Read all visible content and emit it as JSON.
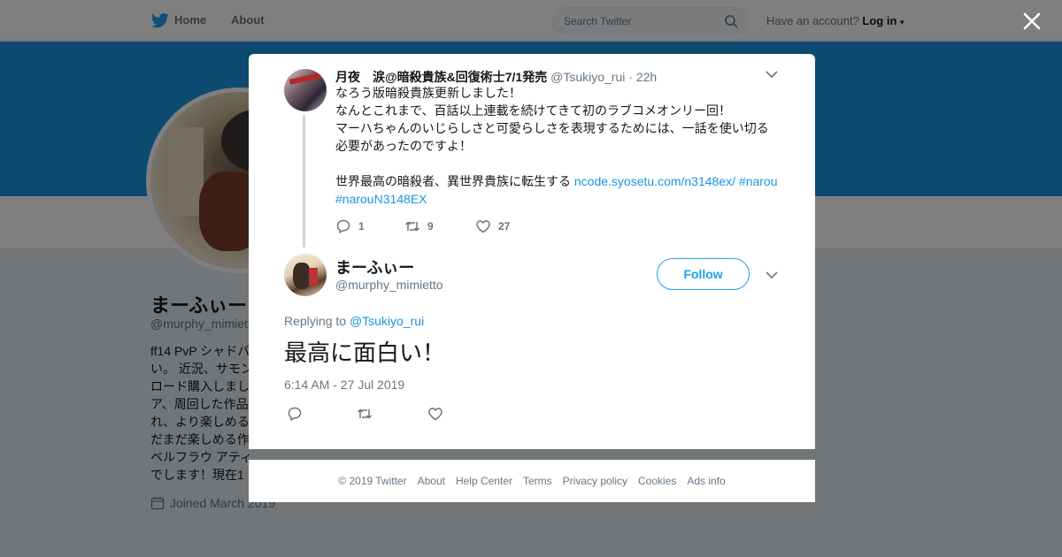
{
  "topbar": {
    "home_label": "Home",
    "about_label": "About",
    "search_placeholder": "Search Twitter",
    "account_prompt": "Have an account?",
    "login_label": "Log in"
  },
  "profile": {
    "name": "まーふぃー",
    "handle": "@murphy_mimietto",
    "bio": "ff14 PvP シャドバ\nい。 近況、サモン\nロード購入しまし\nア、周回した作品\nれ、より楽しめる\nだまだ楽しめる作\nベルフラウ アティ\nでします！現在1",
    "joined": "Joined March 2019"
  },
  "colors": {
    "brand_blue": "#1da1f2",
    "banner_blue": "#1b95e0",
    "link_blue": "#1b95e0",
    "meta_gray": "#657786"
  },
  "parent_tweet": {
    "name": "月夜　涙@暗殺貴族&回復術士7/1発売",
    "handle": "@Tsukiyo_rui",
    "time": "22h",
    "text_lines": [
      "なろう版暗殺貴族更新しました！",
      "なんとこれまで、百話以上連載を続けてきて初のラブコメオンリー回！",
      "マーハちゃんのいじらしさと可愛らしさを表現するためには、一話を使い切る",
      "必要があったのですよ！",
      "",
      "世界最高の暗殺者、異世界貴族に転生する"
    ],
    "link_url": "ncode.syosetu.com/n3148ex/",
    "hashtag1": "#narou",
    "hashtag2": "#narouN3148EX",
    "reply_count": "1",
    "retweet_count": "9",
    "like_count": "27"
  },
  "main_tweet": {
    "name": "まーふぃー",
    "handle": "@murphy_mimietto",
    "follow_label": "Follow",
    "replying_to_label": "Replying to",
    "replying_to_handle": "@Tsukiyo_rui",
    "text": "最高に面白い！",
    "timestamp": "6:14 AM - 27 Jul 2019"
  },
  "footer": {
    "links": [
      "© 2019 Twitter",
      "About",
      "Help Center",
      "Terms",
      "Privacy policy",
      "Cookies",
      "Ads info"
    ]
  },
  "icons": {
    "logo": "twitter-bird-icon",
    "search": "search-icon",
    "close": "close-icon",
    "reply": "reply-icon",
    "retweet": "retweet-icon",
    "like": "heart-icon",
    "caret": "chevron-down-icon",
    "calendar": "calendar-icon"
  }
}
